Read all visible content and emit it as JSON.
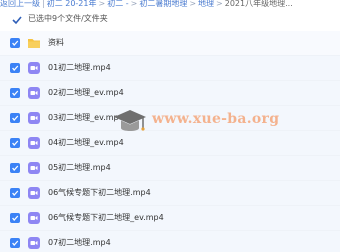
{
  "breadcrumb": {
    "items": [
      "返回上一级",
      "初二 20-21年",
      "初二 -",
      "初二暑期地理",
      "地理",
      "2021八年级地理..."
    ]
  },
  "selection": {
    "status_text": "已选中9个文件/文件夹"
  },
  "files": [
    {
      "name": "资料",
      "type": "folder"
    },
    {
      "name": "01初二地理.mp4",
      "type": "video"
    },
    {
      "name": "02初二地理_ev.mp4",
      "type": "video"
    },
    {
      "name": "03初二地理_ev.mp4",
      "type": "video"
    },
    {
      "name": "04初二地理_ev.mp4",
      "type": "video"
    },
    {
      "name": "05初二地理.mp4",
      "type": "video"
    },
    {
      "name": "06气候专题下初二地理.mp4",
      "type": "video"
    },
    {
      "name": "06气候专题下初二地理_ev.mp4",
      "type": "video"
    },
    {
      "name": "07初二地理.mp4",
      "type": "video"
    }
  ],
  "watermark": {
    "text": "www.xue-ba.org"
  },
  "colors": {
    "accent": "#3b82f6",
    "folder": "#f6c342",
    "video": "#8e86f3",
    "watermark": "#f3a67a"
  }
}
